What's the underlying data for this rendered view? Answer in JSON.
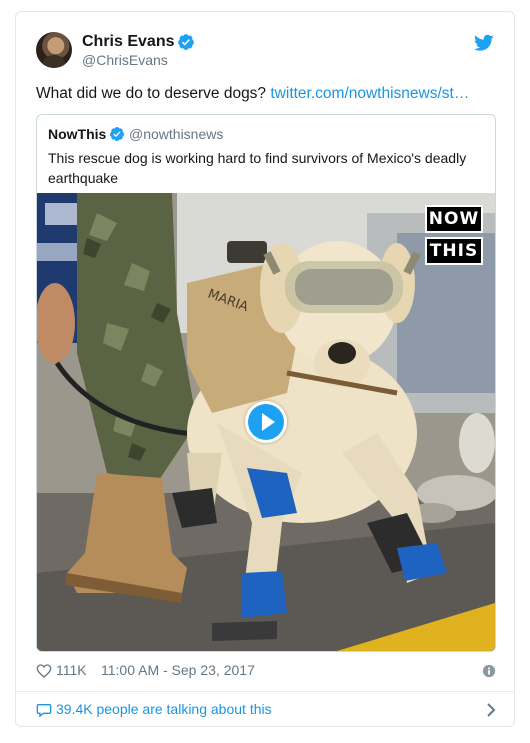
{
  "author": {
    "name": "Chris Evans",
    "handle": "@ChrisEvans"
  },
  "tweet": {
    "text_plain": "What did we do to deserve dogs? ",
    "link_text": "twitter.com/nowthisnews/st…"
  },
  "quoted": {
    "name": "NowThis",
    "handle": "@nowthisnews",
    "text": "This rescue dog is working hard to find survivors of Mexico's deadly earthquake",
    "media": {
      "logo_line1": "NOW",
      "logo_line2": "THIS",
      "vest_text": "MARIA"
    }
  },
  "meta": {
    "likes": "111K",
    "timestamp": "11:00 AM - Sep 23, 2017"
  },
  "footer": {
    "talking": "39.4K people are talking about this"
  },
  "colors": {
    "accent": "#1da1f2",
    "link": "#1b95e0",
    "muted": "#657786",
    "border": "#e1e8ed"
  },
  "icons": [
    "verified-icon",
    "twitter-bird-icon",
    "play-icon",
    "heart-icon",
    "info-icon",
    "comment-bubble-icon",
    "chevron-right-icon"
  ]
}
